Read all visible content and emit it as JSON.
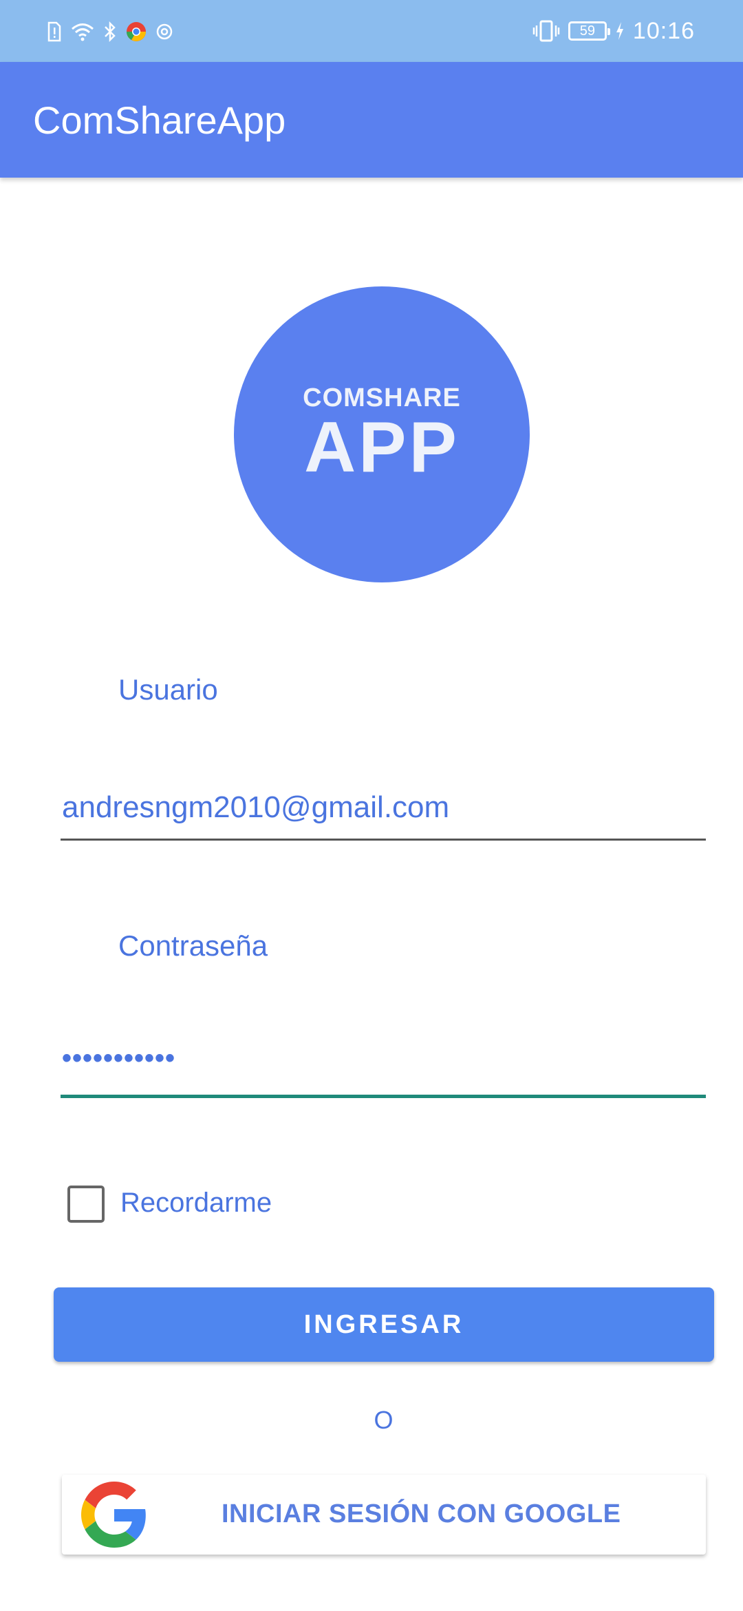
{
  "status_bar": {
    "time": "10:16",
    "battery_level": "59",
    "icons": [
      "sim-alert-icon",
      "wifi-icon",
      "bluetooth-icon",
      "chrome-icon",
      "notification-icon",
      "vibrate-icon",
      "battery-icon",
      "charging-icon"
    ]
  },
  "app_bar": {
    "title": "ComShareApp"
  },
  "logo": {
    "line1": "COMSHARE",
    "line2": "APP",
    "bg_color": "#5a80ef"
  },
  "form": {
    "username_label": "Usuario",
    "username_value": "andresngm2010@gmail.com",
    "password_label": "Contraseña",
    "password_value": "•••••••••••",
    "remember_label": "Recordarme",
    "remember_checked": false
  },
  "buttons": {
    "login_label": "INGRESAR",
    "or_text": "O",
    "google_label": "INICIAR SESIÓN CON GOOGLE"
  },
  "colors": {
    "status_bar": "#8bbcee",
    "app_bar": "#5a80ef",
    "accent_text": "#4a74df",
    "primary_button": "#4f86ef",
    "focused_underline": "#1f8a7a"
  }
}
